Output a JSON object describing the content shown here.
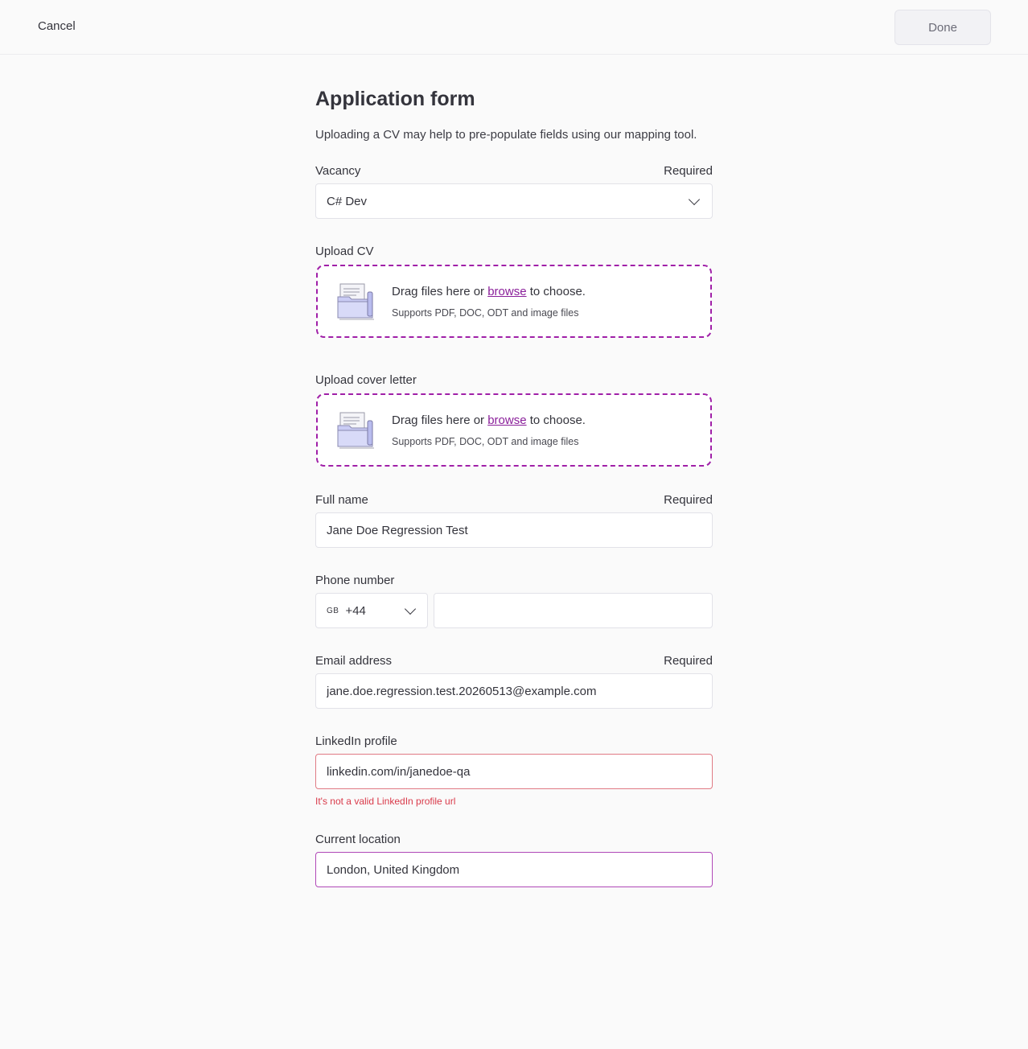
{
  "topbar": {
    "cancel_label": "Cancel",
    "done_label": "Done"
  },
  "form": {
    "title": "Application form",
    "intro": "Uploading a CV may help to pre-populate fields using our mapping tool.",
    "vacancy": {
      "label": "Vacancy",
      "required": "Required",
      "value": "C# Dev"
    },
    "upload_cv": {
      "label": "Upload CV",
      "drag_prefix": "Drag files here or ",
      "browse": "browse",
      "drag_suffix": " to choose.",
      "support": "Supports PDF, DOC, ODT and image files"
    },
    "upload_cover": {
      "label": "Upload cover letter",
      "drag_prefix": "Drag files here or ",
      "browse": "browse",
      "drag_suffix": " to choose.",
      "support": "Supports PDF, DOC, ODT and image files"
    },
    "full_name": {
      "label": "Full name",
      "required": "Required",
      "value": "Jane Doe Regression Test"
    },
    "phone": {
      "label": "Phone number",
      "country_flag": "GB",
      "country_code": "+44",
      "value": ""
    },
    "email": {
      "label": "Email address",
      "required": "Required",
      "value": "jane.doe.regression.test.20260513@example.com"
    },
    "linkedin": {
      "label": "LinkedIn profile",
      "value": "linkedin.com/in/janedoe-qa",
      "error": "It's not a valid LinkedIn profile url"
    },
    "location": {
      "label": "Current location",
      "value": "London, United Kingdom"
    }
  },
  "colors": {
    "accent": "#a020a8",
    "error": "#d93a4a",
    "background": "#fafafa"
  }
}
